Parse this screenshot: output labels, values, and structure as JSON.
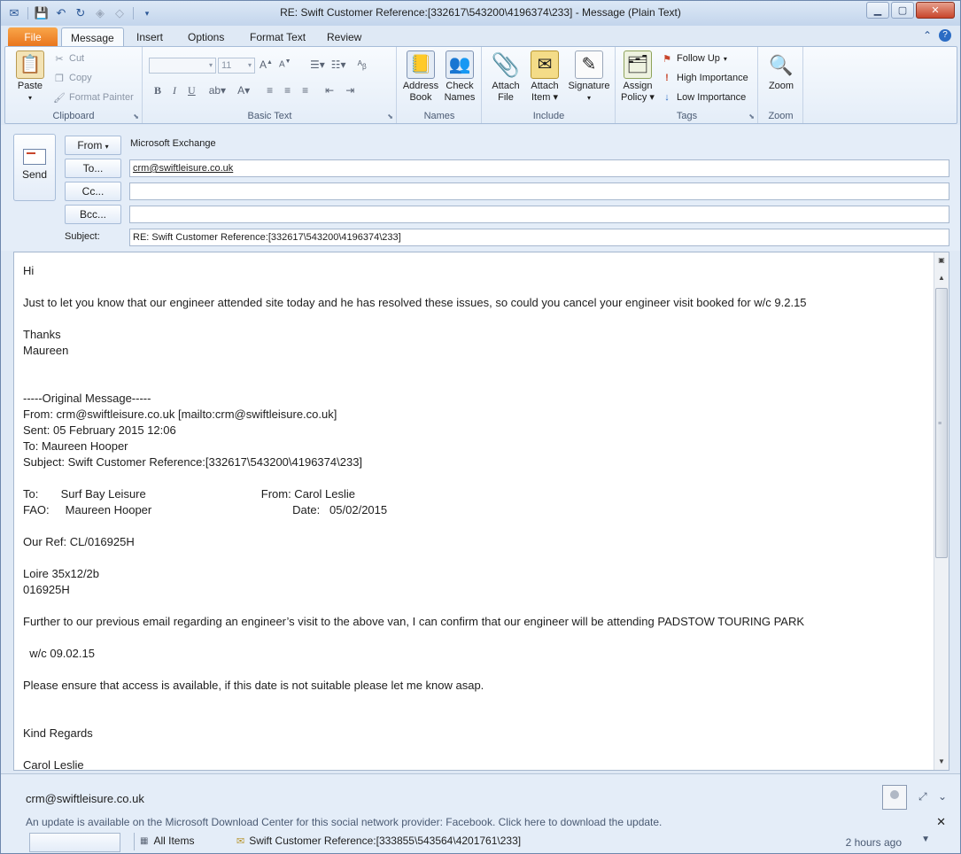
{
  "window": {
    "title": "RE: Swift Customer Reference:[332617\\543200\\4196374\\233]  -  Message (Plain Text)"
  },
  "tabs": [
    "File",
    "Message",
    "Insert",
    "Options",
    "Format Text",
    "Review"
  ],
  "ribbon": {
    "clipboard": {
      "label": "Clipboard",
      "paste": "Paste",
      "cut": "Cut",
      "copy": "Copy",
      "format_painter": "Format Painter"
    },
    "basic_text": {
      "label": "Basic Text",
      "font_size": "11"
    },
    "names": {
      "label": "Names",
      "address_book_1": "Address",
      "address_book_2": "Book",
      "check_names_1": "Check",
      "check_names_2": "Names"
    },
    "include": {
      "label": "Include",
      "attach_file_1": "Attach",
      "attach_file_2": "File",
      "attach_item_1": "Attach",
      "attach_item_2": "Item",
      "signature": "Signature"
    },
    "tags": {
      "label": "Tags",
      "assign_policy_1": "Assign",
      "assign_policy_2": "Policy",
      "follow_up": "Follow Up",
      "high_importance": "High Importance",
      "low_importance": "Low Importance"
    },
    "zoom": {
      "label": "Zoom",
      "zoom": "Zoom"
    }
  },
  "header": {
    "send": "Send",
    "from_btn": "From",
    "from_account": "Microsoft Exchange",
    "to_btn": "To...",
    "to_value": "crm@swiftleisure.co.uk",
    "cc_btn": "Cc...",
    "cc_value": "",
    "bcc_btn": "Bcc...",
    "bcc_value": "",
    "subject_label": "Subject:",
    "subject_value": "RE: Swift Customer Reference:[332617\\543200\\4196374\\233]"
  },
  "body": {
    "text": "Hi\n\nJust to let you know that our engineer attended site today and he has resolved these issues, so could you cancel your engineer visit booked for w/c 9.2.15\n\nThanks\nMaureen\n\n\n-----Original Message-----\nFrom: crm@swiftleisure.co.uk [mailto:crm@swiftleisure.co.uk]\nSent: 05 February 2015 12:06\nTo: Maureen Hooper\nSubject: Swift Customer Reference:[332617\\543200\\4196374\\233]\n\nTo:       Surf Bay Leisure                                    From: Carol Leslie\nFAO:     Maureen Hooper                                            Date:   05/02/2015\n\nOur Ref: CL/016925H\n\nLoire 35x12/2b\n016925H\n\nFurther to our previous email regarding an engineer’s visit to the above van, I can confirm that our engineer will be attending PADSTOW TOURING PARK\n\n  w/c 09.02.15\n\nPlease ensure that access is available, if this date is not suitable please let me know asap.\n\n\nKind Regards\n\nCarol Leslie"
  },
  "people_pane": {
    "email": "crm@swiftleisure.co.uk",
    "update_message": "An update is available on the Microsoft Download Center for this social network provider: Facebook. Click here to download the update.",
    "all_items": "All Items",
    "feed_subject": "Swift Customer Reference:[333855\\543564\\4201761\\233]",
    "feed_time": "2 hours ago"
  },
  "colors": {
    "file_tab": "#e8731b",
    "accent": "#2b5797"
  }
}
